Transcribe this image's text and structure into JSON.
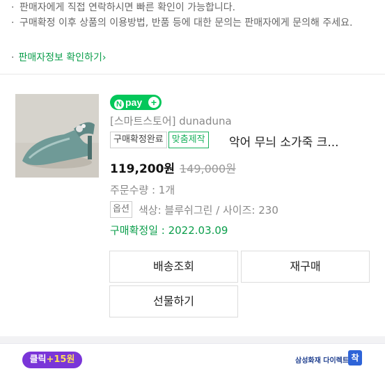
{
  "notice": {
    "bullet": "·",
    "line1": "판매자에게 직접 연락하시면 빠른 확인이 가능합니다.",
    "line2": "구매확정 이후 상품의 이용방법, 반품 등에 대한 문의는 판매자에게 문의해 주세요.",
    "seller_info_link": "판매자정보 확인하기",
    "link_chevron": "›"
  },
  "order": {
    "pay_badge": "pay",
    "pay_badge_n": "N",
    "pay_badge_plus": "+",
    "seller": "[스마트스토어] dunaduna",
    "status_badge": "구매확정완료",
    "custom_badge": "맞춤제작",
    "product_name": "악어 무늬 소가죽 크...",
    "price": "119,200원",
    "original_price": "149,000원",
    "quantity": "주문수량 : 1개",
    "option_tag": "옵션",
    "option_text": "색상: 블루쉬그린 / 사이즈: 230",
    "confirm_date": "구매확정일 : 2022.03.09"
  },
  "buttons": {
    "delivery": "배송조회",
    "rebuy": "재구매",
    "gift": "선물하기"
  },
  "ad": {
    "click_label": "클릭",
    "click_reward": "+15원",
    "insurer": "삼성화재 다이렉트",
    "insurer_mark": "착"
  },
  "colors": {
    "naver_green": "#03c75a",
    "confirm_green": "#0b9e4b",
    "click_purple": "#7a35d8"
  }
}
